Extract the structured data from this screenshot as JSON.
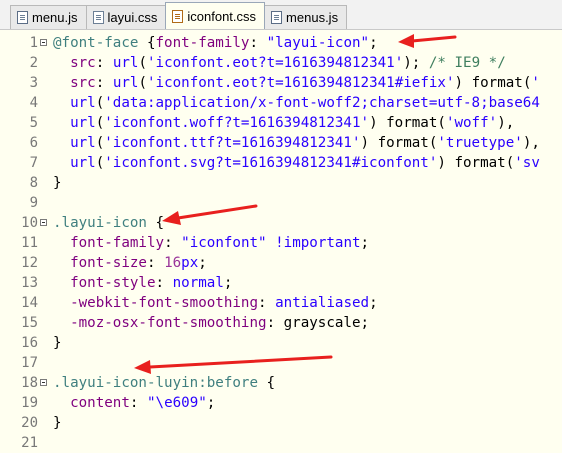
{
  "tabs": [
    {
      "label": "menu.js",
      "icon": "js-file-icon"
    },
    {
      "label": "layui.css",
      "icon": "file-icon"
    },
    {
      "label": "iconfont.css",
      "icon": "css-file-icon",
      "active": true
    },
    {
      "label": "menus.js",
      "icon": "js-file-icon"
    }
  ],
  "lines": [
    {
      "n": "1",
      "fold": true,
      "segs": [
        [
          "kw",
          "@font-face"
        ],
        [
          "",
          " {"
        ],
        [
          "prop",
          "font-family"
        ],
        [
          "",
          ": "
        ],
        [
          "str",
          "\"layui-icon\""
        ],
        [
          "",
          ";"
        ]
      ]
    },
    {
      "n": "2",
      "segs": [
        [
          "",
          "  "
        ],
        [
          "prop",
          "src"
        ],
        [
          "",
          ": "
        ],
        [
          "val",
          "url"
        ],
        [
          "",
          "("
        ],
        [
          "str",
          "'iconfont.eot?t=1616394812341'"
        ],
        [
          "",
          "); "
        ],
        [
          "cmt",
          "/* IE9 */"
        ]
      ]
    },
    {
      "n": "3",
      "segs": [
        [
          "",
          "  "
        ],
        [
          "prop",
          "src"
        ],
        [
          "",
          ": "
        ],
        [
          "val",
          "url"
        ],
        [
          "",
          "("
        ],
        [
          "str",
          "'iconfont.eot?t=1616394812341#iefix'"
        ],
        [
          "",
          ") format("
        ],
        [
          "str",
          "'"
        ]
      ]
    },
    {
      "n": "4",
      "segs": [
        [
          "",
          "  "
        ],
        [
          "val",
          "url"
        ],
        [
          "",
          "("
        ],
        [
          "str",
          "'data:application/x-font-woff2;charset=utf-8;base64"
        ]
      ]
    },
    {
      "n": "5",
      "segs": [
        [
          "",
          "  "
        ],
        [
          "val",
          "url"
        ],
        [
          "",
          "("
        ],
        [
          "str",
          "'iconfont.woff?t=1616394812341'"
        ],
        [
          "",
          ") format("
        ],
        [
          "str",
          "'woff'"
        ],
        [
          "",
          "),"
        ]
      ]
    },
    {
      "n": "6",
      "segs": [
        [
          "",
          "  "
        ],
        [
          "val",
          "url"
        ],
        [
          "",
          "("
        ],
        [
          "str",
          "'iconfont.ttf?t=1616394812341'"
        ],
        [
          "",
          ") format("
        ],
        [
          "str",
          "'truetype'"
        ],
        [
          "",
          "),"
        ]
      ]
    },
    {
      "n": "7",
      "segs": [
        [
          "",
          "  "
        ],
        [
          "val",
          "url"
        ],
        [
          "",
          "("
        ],
        [
          "str",
          "'iconfont.svg?t=1616394812341#iconfont'"
        ],
        [
          "",
          ") format("
        ],
        [
          "str",
          "'sv"
        ]
      ]
    },
    {
      "n": "8",
      "segs": [
        [
          "",
          "}"
        ]
      ]
    },
    {
      "n": "9",
      "segs": []
    },
    {
      "n": "10",
      "fold": true,
      "segs": [
        [
          "sel",
          ".layui-icon"
        ],
        [
          "",
          " {"
        ]
      ]
    },
    {
      "n": "11",
      "segs": [
        [
          "",
          "  "
        ],
        [
          "prop",
          "font-family"
        ],
        [
          "",
          ": "
        ],
        [
          "str",
          "\"iconfont\""
        ],
        [
          "",
          " "
        ],
        [
          "kwd",
          "!important"
        ],
        [
          "",
          ";"
        ]
      ]
    },
    {
      "n": "12",
      "segs": [
        [
          "",
          "  "
        ],
        [
          "prop",
          "font-size"
        ],
        [
          "",
          ": "
        ],
        [
          "num",
          "16"
        ],
        [
          "val",
          "px"
        ],
        [
          "",
          ";"
        ]
      ]
    },
    {
      "n": "13",
      "segs": [
        [
          "",
          "  "
        ],
        [
          "prop",
          "font-style"
        ],
        [
          "",
          ": "
        ],
        [
          "val",
          "normal"
        ],
        [
          "",
          ";"
        ]
      ]
    },
    {
      "n": "14",
      "segs": [
        [
          "",
          "  "
        ],
        [
          "prop",
          "-webkit-font-smoothing"
        ],
        [
          "",
          ": "
        ],
        [
          "val",
          "antialiased"
        ],
        [
          "",
          ";"
        ]
      ]
    },
    {
      "n": "15",
      "segs": [
        [
          "",
          "  "
        ],
        [
          "prop",
          "-moz-osx-font-smoothing"
        ],
        [
          "",
          ": grayscale;"
        ]
      ]
    },
    {
      "n": "16",
      "segs": [
        [
          "",
          "}"
        ]
      ]
    },
    {
      "n": "17",
      "segs": []
    },
    {
      "n": "18",
      "fold": true,
      "segs": [
        [
          "sel",
          ".layui-icon-luyin:before"
        ],
        [
          "",
          " {"
        ]
      ]
    },
    {
      "n": "19",
      "segs": [
        [
          "",
          "  "
        ],
        [
          "prop",
          "content"
        ],
        [
          "",
          ": "
        ],
        [
          "str",
          "\"\\e609\""
        ],
        [
          "",
          ";"
        ]
      ]
    },
    {
      "n": "20",
      "segs": [
        [
          "",
          "}"
        ]
      ]
    },
    {
      "n": "21",
      "segs": []
    }
  ],
  "colors": {
    "background": "#fffff0",
    "annotation_arrow": "#e8201e"
  }
}
